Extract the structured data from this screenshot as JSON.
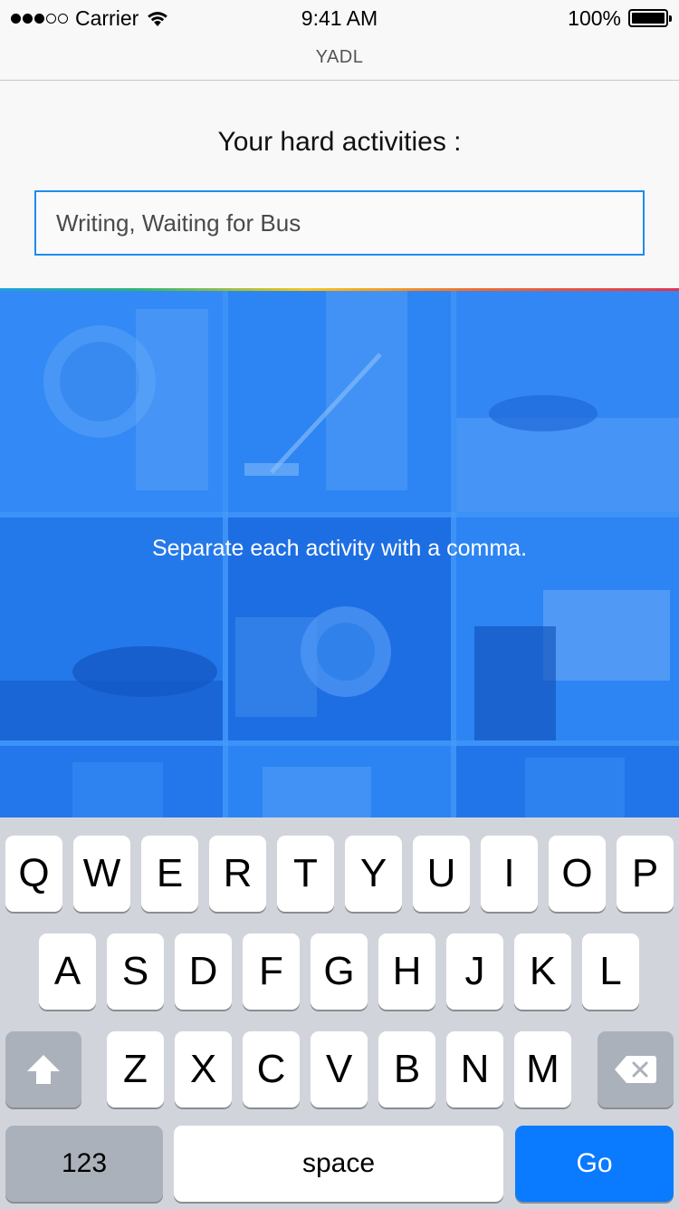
{
  "status_bar": {
    "carrier": "Carrier",
    "time": "9:41 AM",
    "battery": "100%",
    "signal_bars": 3,
    "signal_max": 5
  },
  "nav": {
    "title": "YADL"
  },
  "question": {
    "title": "Your hard activities :",
    "input_value": "Writing, Waiting for Bus"
  },
  "panel": {
    "hint": "Separate each activity with a comma.",
    "background_color": "#2a82f4"
  },
  "keyboard": {
    "row1": [
      "Q",
      "W",
      "E",
      "R",
      "T",
      "Y",
      "U",
      "I",
      "O",
      "P"
    ],
    "row2": [
      "A",
      "S",
      "D",
      "F",
      "G",
      "H",
      "J",
      "K",
      "L"
    ],
    "row3": [
      "Z",
      "X",
      "C",
      "V",
      "B",
      "N",
      "M"
    ],
    "numbers_label": "123",
    "space_label": "space",
    "go_label": "Go",
    "shift_icon": "shift-arrow-icon",
    "delete_icon": "backspace-icon",
    "accent_color": "#0a7aff"
  }
}
